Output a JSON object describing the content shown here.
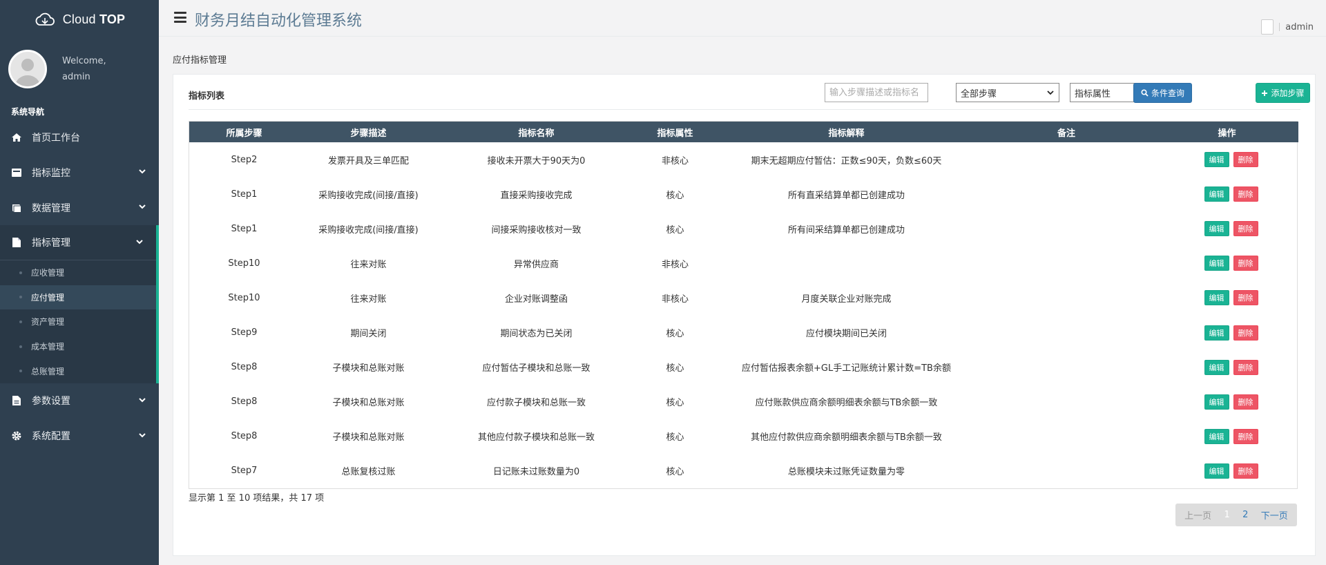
{
  "brand": {
    "name_light": "Cloud ",
    "name_bold": "TOP"
  },
  "profile": {
    "welcome": "Welcome,",
    "username": "admin"
  },
  "sidebar": {
    "title": "系统导航",
    "items": [
      {
        "label": "首页工作台",
        "icon": "home-icon"
      },
      {
        "label": "指标监控",
        "icon": "monitor-icon"
      },
      {
        "label": "数据管理",
        "icon": "book-icon"
      },
      {
        "label": "指标管理",
        "icon": "file-icon"
      },
      {
        "label": "参数设置",
        "icon": "document-icon"
      },
      {
        "label": "系统配置",
        "icon": "gear-icon"
      }
    ],
    "sub_items": [
      "应收管理",
      "应付管理",
      "资产管理",
      "成本管理",
      "总账管理"
    ]
  },
  "header": {
    "title": "财务月结自动化管理系统",
    "user": "admin"
  },
  "breadcrumb": "应付指标管理",
  "list": {
    "title": "指标列表",
    "search_placeholder": "输入步骤描述或指标名",
    "step_filter": "全部步骤",
    "attr_filter": "指标属性",
    "query_button": "条件查询",
    "add_button": "添加步骤"
  },
  "table": {
    "columns": [
      "所属步骤",
      "步骤描述",
      "指标名称",
      "指标属性",
      "指标解释",
      "备注",
      "操作"
    ],
    "edit_label": "编辑",
    "delete_label": "删除",
    "rows": [
      [
        "Step2",
        "发票开具及三单匹配",
        "接收未开票大于90天为0",
        "非核心",
        "期末无超期应付暂估：正数≤90天，负数≤60天",
        ""
      ],
      [
        "Step1",
        "采购接收完成(间接/直接)",
        "直接采购接收完成",
        "核心",
        "所有直采结算单都已创建成功",
        ""
      ],
      [
        "Step1",
        "采购接收完成(间接/直接)",
        "间接采购接收核对一致",
        "核心",
        "所有间采结算单都已创建成功",
        ""
      ],
      [
        "Step10",
        "往来对账",
        "异常供应商",
        "非核心",
        "",
        ""
      ],
      [
        "Step10",
        "往来对账",
        "企业对账调整函",
        "非核心",
        "月度关联企业对账完成",
        ""
      ],
      [
        "Step9",
        "期间关闭",
        "期间状态为已关闭",
        "核心",
        "应付模块期间已关闭",
        ""
      ],
      [
        "Step8",
        "子模块和总账对账",
        "应付暂估子模块和总账一致",
        "核心",
        "应付暂估报表余额+GL手工记账统计累计数=TB余额",
        ""
      ],
      [
        "Step8",
        "子模块和总账对账",
        "应付款子模块和总账一致",
        "核心",
        "应付账款供应商余额明细表余额与TB余额一致",
        ""
      ],
      [
        "Step8",
        "子模块和总账对账",
        "其他应付款子模块和总账一致",
        "核心",
        "其他应付款供应商余额明细表余额与TB余额一致",
        ""
      ],
      [
        "Step7",
        "总账复核过账",
        "日记账未过账数量为0",
        "核心",
        "总账模块未过账凭证数量为零",
        ""
      ]
    ]
  },
  "summary": "显示第 1 至 10 项结果，共 17 项",
  "pagination": {
    "prev": "上一页",
    "pages": [
      "1",
      "2"
    ],
    "next": "下一页"
  }
}
